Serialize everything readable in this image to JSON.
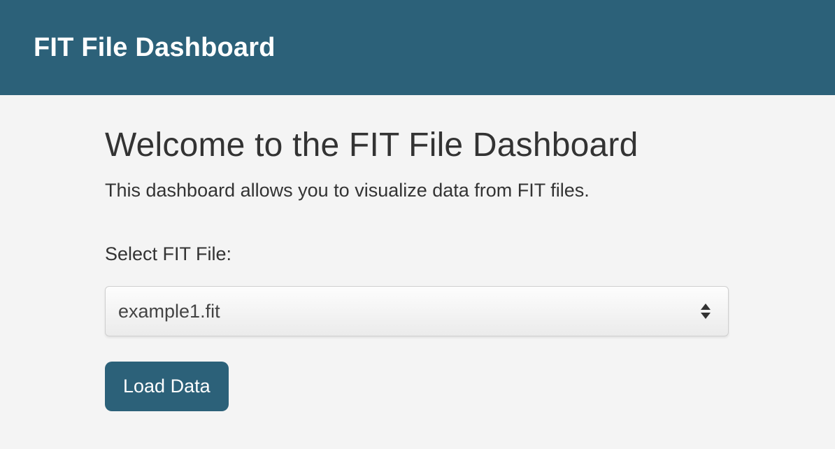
{
  "header": {
    "title": "FIT File Dashboard"
  },
  "main": {
    "welcome_heading": "Welcome to the FIT File Dashboard",
    "welcome_desc": "This dashboard allows you to visualize data from FIT files.",
    "select_label": "Select FIT File:",
    "selected_file": "example1.fit",
    "load_button_label": "Load Data"
  },
  "colors": {
    "brand": "#2c6179",
    "background": "#f4f4f4",
    "text": "#333333"
  }
}
